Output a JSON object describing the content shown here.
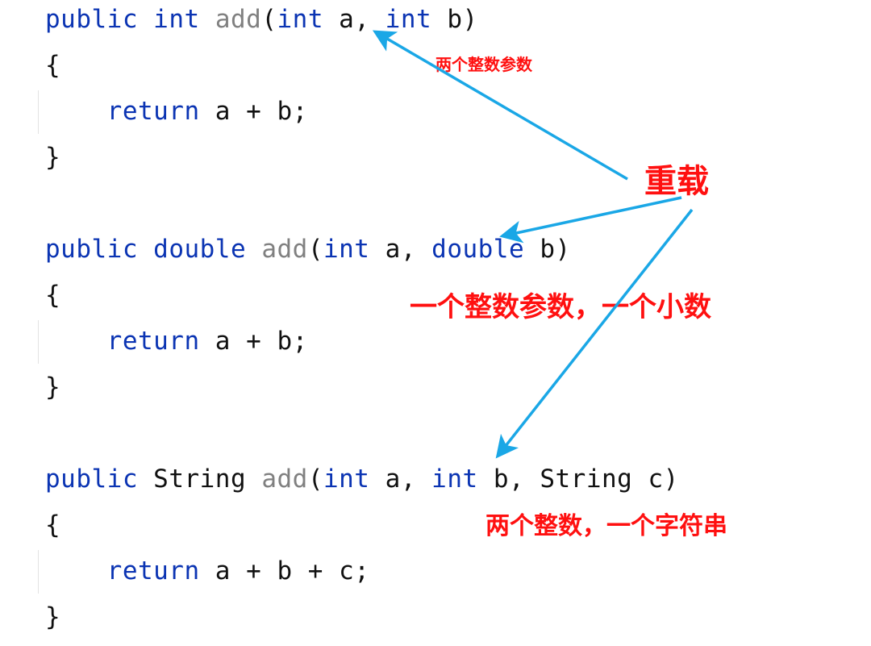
{
  "colors": {
    "keyword": "#0b34b3",
    "method_name": "#808080",
    "plain": "#111111",
    "annotation": "#ff1010",
    "arrow": "#1aa7e6"
  },
  "methods": [
    {
      "signature": {
        "modifier": "public",
        "return_type": "int",
        "return_type_is_keyword": true,
        "name": "add",
        "params": [
          {
            "type": "int",
            "type_is_keyword": true,
            "name": "a"
          },
          {
            "type": "int",
            "type_is_keyword": true,
            "name": "b"
          }
        ]
      },
      "open_brace": "{",
      "body_keyword": "return",
      "body_expr": " a + b;",
      "close_brace": "}",
      "annotation": "两个整数参数"
    },
    {
      "signature": {
        "modifier": "public",
        "return_type": "double",
        "return_type_is_keyword": true,
        "name": "add",
        "params": [
          {
            "type": "int",
            "type_is_keyword": true,
            "name": "a"
          },
          {
            "type": "double",
            "type_is_keyword": true,
            "name": "b"
          }
        ]
      },
      "open_brace": "{",
      "body_keyword": "return",
      "body_expr": " a + b;",
      "close_brace": "}",
      "annotation": "一个整数参数，一个小数"
    },
    {
      "signature": {
        "modifier": "public",
        "return_type": "String",
        "return_type_is_keyword": false,
        "name": "add",
        "params": [
          {
            "type": "int",
            "type_is_keyword": true,
            "name": "a"
          },
          {
            "type": "int",
            "type_is_keyword": true,
            "name": "b"
          },
          {
            "type": "String",
            "type_is_keyword": false,
            "name": "c"
          }
        ]
      },
      "open_brace": "{",
      "body_keyword": "return",
      "body_expr": " a + b + c;",
      "close_brace": "}",
      "annotation": "两个整数，一个字符串"
    }
  ],
  "overload_label": "重载",
  "punct": {
    "space": " ",
    "open_paren": "(",
    "close_paren": ")",
    "comma": ", ",
    "indent": "    "
  }
}
